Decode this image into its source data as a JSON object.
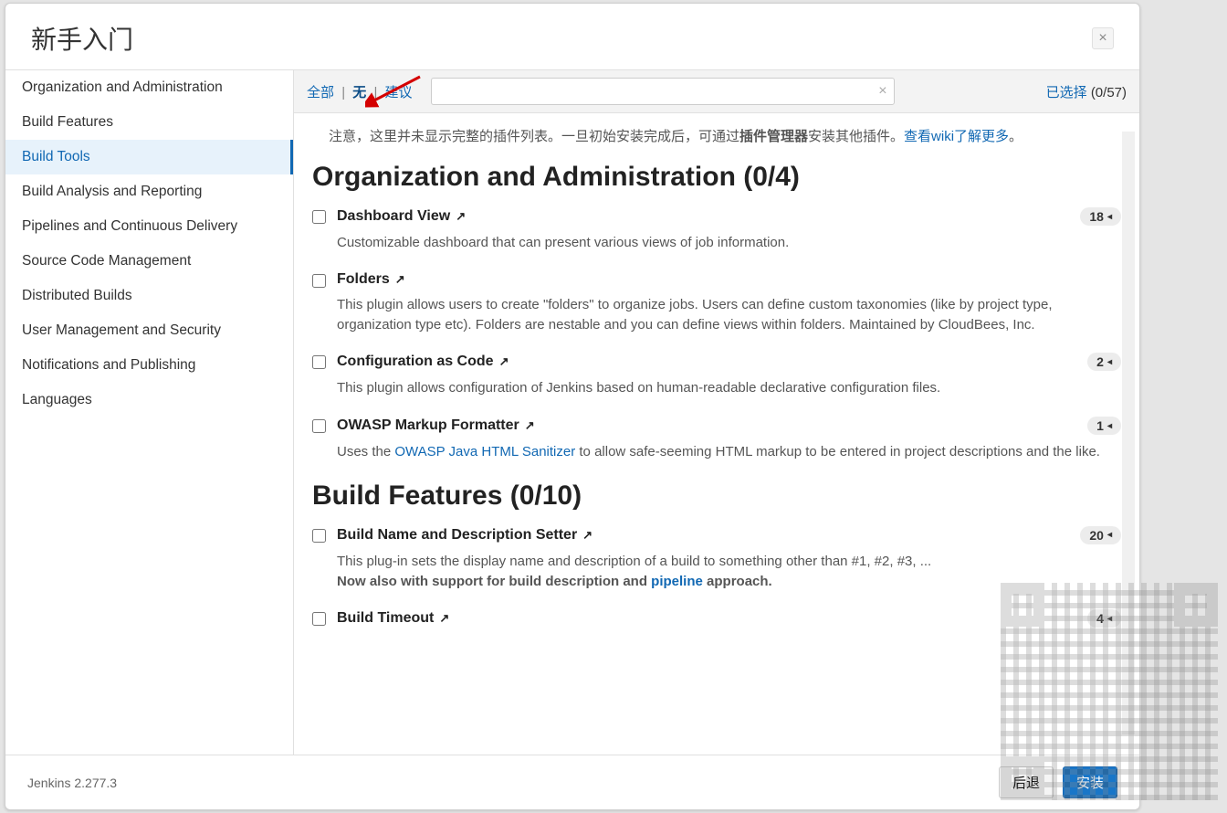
{
  "dialog": {
    "title": "新手入门",
    "close": "×"
  },
  "sidebar": {
    "items": [
      "Organization and Administration",
      "Build Features",
      "Build Tools",
      "Build Analysis and Reporting",
      "Pipelines and Continuous Delivery",
      "Source Code Management",
      "Distributed Builds",
      "User Management and Security",
      "Notifications and Publishing",
      "Languages"
    ],
    "activeIndex": 2
  },
  "toolbar": {
    "filters": {
      "all": "全部",
      "none": "无",
      "suggested": "建议"
    },
    "sep": "|",
    "clear": "×",
    "selected_label": "已选择",
    "selected_count": "(0/57)"
  },
  "notice": {
    "pre": "注意，这里并未显示完整的插件列表。一旦初始安装完成后，可通过",
    "bold": "插件管理器",
    "mid": "安装其他插件。",
    "link": "查看wiki了解更多",
    "tail": "。"
  },
  "sections": [
    {
      "title": "Organization and Administration (0/4)",
      "plugins": [
        {
          "name": "Dashboard View",
          "badge": "18",
          "desc": "Customizable dashboard that can present various views of job information."
        },
        {
          "name": "Folders",
          "desc": "This plugin allows users to create \"folders\" to organize jobs. Users can define custom taxonomies (like by project type, organization type etc). Folders are nestable and you can define views within folders. Maintained by CloudBees, Inc."
        },
        {
          "name": "Configuration as Code",
          "badge": "2",
          "desc": "This plugin allows configuration of Jenkins based on human-readable declarative configuration files."
        },
        {
          "name": "OWASP Markup Formatter",
          "badge": "1",
          "desc_pre": "Uses the ",
          "desc_link": "OWASP Java HTML Sanitizer",
          "desc_post": " to allow safe-seeming HTML markup to be entered in project descriptions and the like."
        }
      ]
    },
    {
      "title": "Build Features (0/10)",
      "plugins": [
        {
          "name": "Build Name and Description Setter",
          "badge": "20",
          "desc_line1": "This plug-in sets the display name and description of a build to something other than #1, #2, #3, ...",
          "desc_bold": "Now also with support for build description and ",
          "desc_link": "pipeline",
          "desc_bold2": " approach."
        },
        {
          "name": "Build Timeout",
          "badge": "4"
        }
      ]
    }
  ],
  "footer": {
    "version": "Jenkins 2.277.3",
    "back": "后退",
    "install": "安装"
  },
  "icons": {
    "ext": "↗",
    "tri": "◂"
  }
}
